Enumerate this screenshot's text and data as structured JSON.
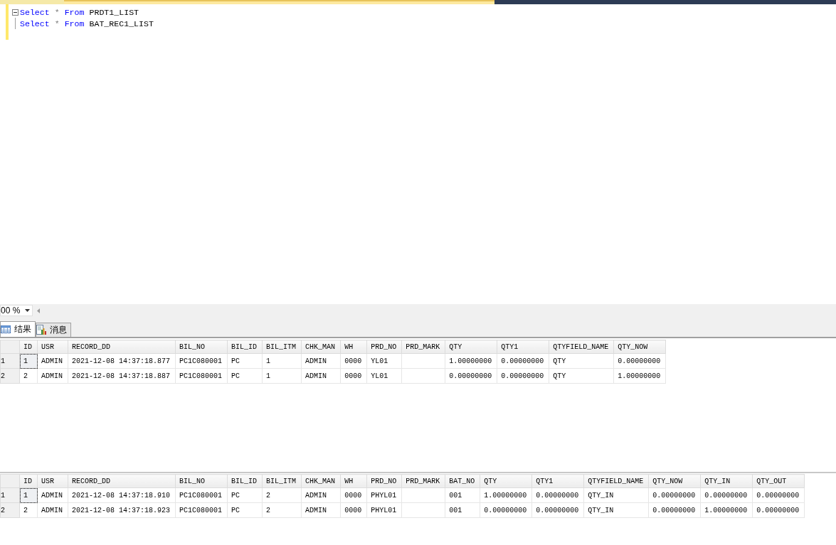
{
  "editor": {
    "lines": [
      {
        "foldable": true,
        "tokens": [
          {
            "text": "Select",
            "kind": "keyword"
          },
          {
            "text": "*",
            "kind": "operator"
          },
          {
            "text": "From",
            "kind": "keyword"
          },
          {
            "text": "PRDT1_LIST",
            "kind": "identifier"
          }
        ]
      },
      {
        "foldable": false,
        "tokens": [
          {
            "text": "Select",
            "kind": "keyword"
          },
          {
            "text": "*",
            "kind": "operator"
          },
          {
            "text": "From",
            "kind": "keyword"
          },
          {
            "text": "BAT_REC1_LIST",
            "kind": "identifier"
          }
        ]
      }
    ]
  },
  "zoom": {
    "value": "00 %"
  },
  "tabs": [
    {
      "label": "结果",
      "selected": true,
      "kind": "grid"
    },
    {
      "label": "消息",
      "selected": false,
      "kind": "messages"
    }
  ],
  "result_sets": [
    {
      "columns": [
        "ID",
        "USR",
        "RECORD_DD",
        "BIL_NO",
        "BIL_ID",
        "BIL_ITM",
        "CHK_MAN",
        "WH",
        "PRD_NO",
        "PRD_MARK",
        "QTY",
        "QTY1",
        "QTYFIELD_NAME",
        "QTY_NOW"
      ],
      "rows": [
        {
          "number": "1",
          "focused": true,
          "cells": [
            "1",
            "ADMIN",
            "2021-12-08 14:37:18.877",
            "PC1C080001",
            "PC",
            "1",
            "ADMIN",
            "0000",
            "YL01",
            "",
            "1.00000000",
            "0.00000000",
            "QTY",
            "0.00000000"
          ]
        },
        {
          "number": "2",
          "focused": false,
          "cells": [
            "2",
            "ADMIN",
            "2021-12-08 14:37:18.887",
            "PC1C080001",
            "PC",
            "1",
            "ADMIN",
            "0000",
            "YL01",
            "",
            "0.00000000",
            "0.00000000",
            "QTY",
            "1.00000000"
          ]
        }
      ]
    },
    {
      "columns": [
        "ID",
        "USR",
        "RECORD_DD",
        "BIL_NO",
        "BIL_ID",
        "BIL_ITM",
        "CHK_MAN",
        "WH",
        "PRD_NO",
        "PRD_MARK",
        "BAT_NO",
        "QTY",
        "QTY1",
        "QTYFIELD_NAME",
        "QTY_NOW",
        "QTY_IN",
        "QTY_OUT"
      ],
      "rows": [
        {
          "number": "1",
          "focused": true,
          "cells": [
            "1",
            "ADMIN",
            "2021-12-08 14:37:18.910",
            "PC1C080001",
            "PC",
            "2",
            "ADMIN",
            "0000",
            "PHYL01",
            "",
            "001",
            "1.00000000",
            "0.00000000",
            "QTY_IN",
            "0.00000000",
            "0.00000000",
            "0.00000000"
          ]
        },
        {
          "number": "2",
          "focused": false,
          "cells": [
            "2",
            "ADMIN",
            "2021-12-08 14:37:18.923",
            "PC1C080001",
            "PC",
            "2",
            "ADMIN",
            "0000",
            "PHYL01",
            "",
            "001",
            "0.00000000",
            "0.00000000",
            "QTY_IN",
            "0.00000000",
            "1.00000000",
            "0.00000000"
          ]
        }
      ]
    }
  ]
}
